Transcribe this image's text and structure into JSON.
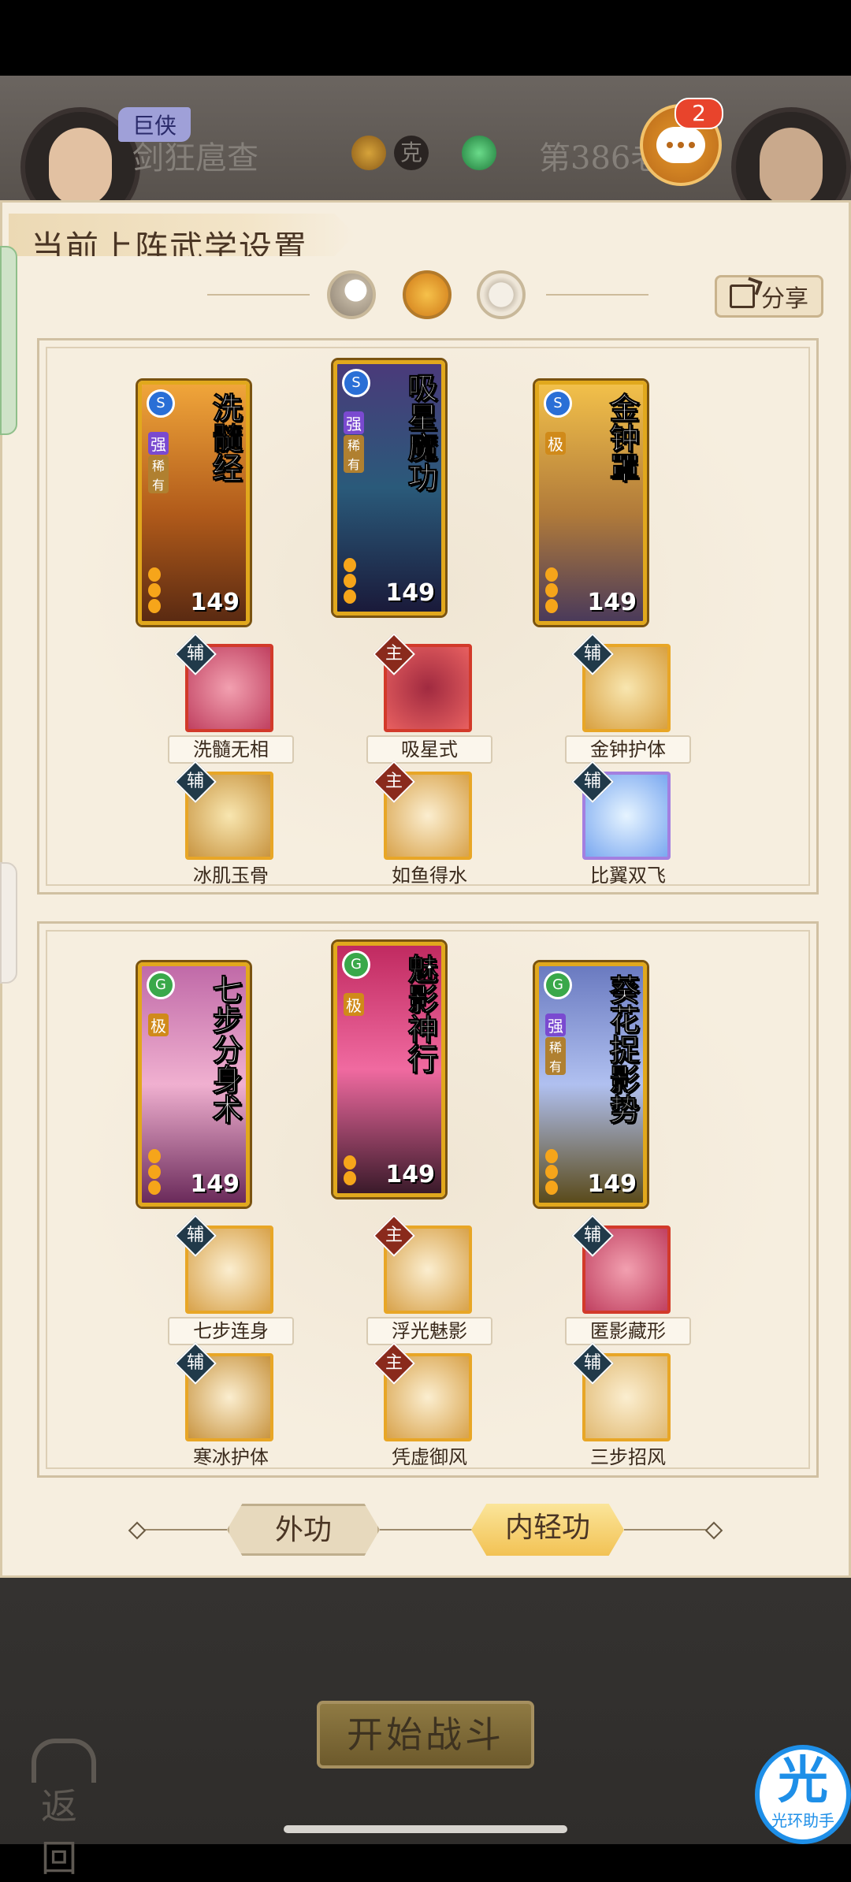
{
  "header": {
    "player_rank": "巨侠",
    "player_name": "剑狂扈查",
    "vs_text": "克",
    "opponent_label": "第386老",
    "chat_badge_count": "2"
  },
  "modal": {
    "title": "当前上阵武学设置",
    "share_label": "分享",
    "mode_icons": [
      "moon-icon",
      "sun-icon",
      "ring-icon"
    ],
    "selected_mode": "sun"
  },
  "panels": [
    {
      "cards": [
        {
          "name": "洗髓经",
          "element": "S",
          "tier": [
            "强",
            "稀有"
          ],
          "level": "149",
          "pips": 3
        },
        {
          "name": "吸星魔功",
          "element": "S",
          "tier": [
            "强",
            "稀有"
          ],
          "level": "149",
          "pips": 3
        },
        {
          "name": "金钟罩",
          "element": "S",
          "tier": [
            "极"
          ],
          "level": "149",
          "pips": 3
        }
      ],
      "skills_row1": [
        {
          "badge": "辅",
          "label": "洗髓无相",
          "frame": "red"
        },
        {
          "badge": "主",
          "label": "吸星式",
          "frame": "red"
        },
        {
          "badge": "辅",
          "label": "金钟护体",
          "frame": "gold"
        }
      ],
      "skills_row2": [
        {
          "badge": "辅",
          "label": "冰肌玉骨",
          "frame": "gold"
        },
        {
          "badge": "主",
          "label": "如鱼得水",
          "frame": "gold"
        },
        {
          "badge": "辅",
          "label": "比翼双飞",
          "frame": "purple"
        }
      ]
    },
    {
      "cards": [
        {
          "name": "七步分身术",
          "element": "G",
          "tier": [
            "极"
          ],
          "level": "149",
          "pips": 3
        },
        {
          "name": "魅影神行",
          "element": "G",
          "tier": [
            "极"
          ],
          "level": "149",
          "pips": 2
        },
        {
          "name": "葵花捉影势",
          "element": "G",
          "tier": [
            "强",
            "稀有"
          ],
          "level": "149",
          "pips": 3
        }
      ],
      "skills_row1": [
        {
          "badge": "辅",
          "label": "七步连身",
          "frame": "gold"
        },
        {
          "badge": "主",
          "label": "浮光魅影",
          "frame": "gold"
        },
        {
          "badge": "辅",
          "label": "匿影藏形",
          "frame": "red"
        }
      ],
      "skills_row2": [
        {
          "badge": "辅",
          "label": "寒冰护体",
          "frame": "gold"
        },
        {
          "badge": "主",
          "label": "凭虚御风",
          "frame": "gold"
        },
        {
          "badge": "辅",
          "label": "三步招风",
          "frame": "gold"
        }
      ]
    }
  ],
  "bottom_tabs": [
    {
      "label": "外功",
      "active": false
    },
    {
      "label": "内轻功",
      "active": true
    }
  ],
  "footer": {
    "start_label": "开始战斗",
    "back_label": "返回",
    "helper_glyph": "光",
    "helper_label": "光环助手"
  },
  "colors": {
    "modal_bg": "#f6eedf",
    "card_frame": "#e1a81d",
    "main_badge": "#8a2a1c",
    "aux_badge": "#213a4a",
    "active_tab": "#f2c254"
  }
}
